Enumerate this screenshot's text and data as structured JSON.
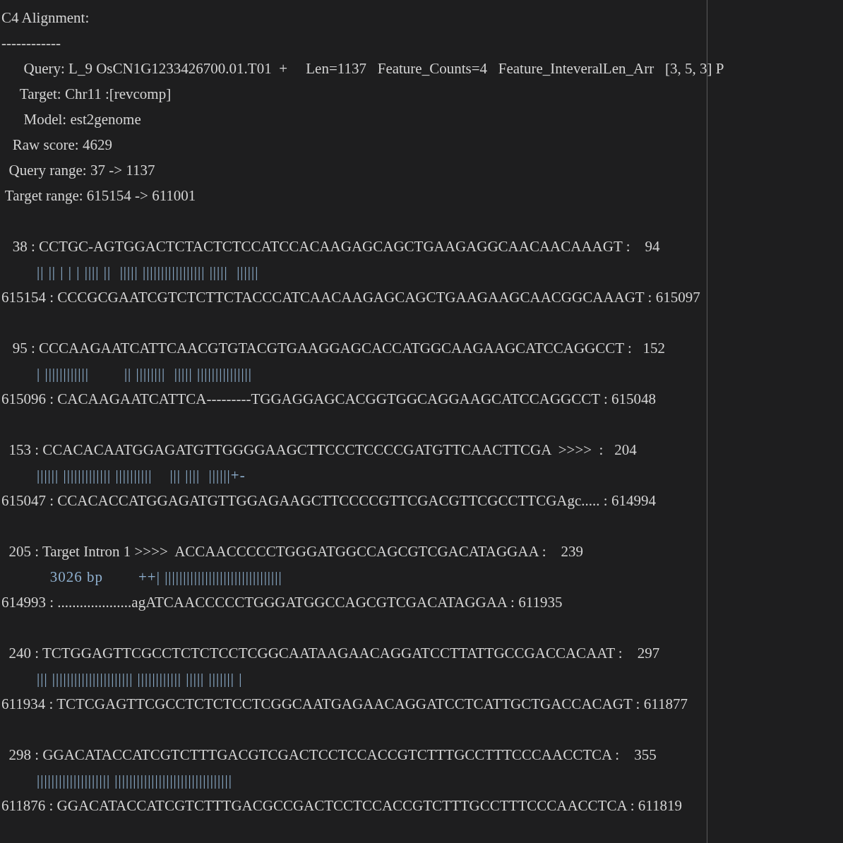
{
  "header_lines": [
    "C4 Alignment:",
    "------------",
    "      Query: L_9 OsCN1G1233426700.01.T01  +     Len=1137   Feature_Counts=4   Feature_InteveralLen_Arr   [3, 5, 3] P",
    "     Target: Chr11 :[revcomp]",
    "      Model: est2genome",
    "   Raw score: 4629",
    "  Query range: 37 -> 1137",
    " Target range: 615154 -> 611001"
  ],
  "blocks": [
    {
      "query": "   38 : CCTGC-AGTGGACTCTACTCTCCATCCACAAGAGCAGCTGAAGAGGCAACAACAAAGT :    94",
      "match": "        || || | | | |||| ||  ||||| ||||||||||||||||| |||||  ||||||",
      "target": "615154 : CCCGCGAATCGTCTCTTCTACCCATCAACAAGAGCAGCTGAAGAAGCAACGGCAAAGT : 615097"
    },
    {
      "query": "   95 : CCCAAGAATCATTCAACGTGTACGTGAAGGAGCACCATGGCAAGAAGCATCCAGGCCT :   152",
      "match": "        | ||||||||||||        || ||||||||  ||||| |||||||||||||||",
      "target": "615096 : CACAAGAATCATTCA---------TGGAGGAGCACGGTGGCAGGAAGCATCCAGGCCT : 615048"
    },
    {
      "query": "  153 : CCACACAATGGAGATGTTGGGGAAGCTTCCCTCCCCGATGTTCAACTTCGA  >>>>  :   204",
      "match": "        |||||| ||||||||||||| ||||||||||    ||| ||||  ||||||+-",
      "target": "615047 : CCACACCATGGAGATGTTGGAGAAGCTTCCCCGTTCGACGTTCGCCTTCGAgc..... : 614994"
    },
    {
      "query": "  205 : Target Intron 1 >>>>  ACCAACCCCCTGGGATGGCCAGCGTCGACATAGGAA :    239",
      "match": "           3026 bp        ++| ||||||||||||||||||||||||||||||||",
      "target": "614993 : ....................agATCAACCCCCTGGGATGGCCAGCGTCGACATAGGAA : 611935"
    },
    {
      "query": "  240 : TCTGGAGTTCGCCTCTCTCCTCGGCAATAAGAACAGGATCCTTATTGCCGACCACAAT :    297",
      "match": "        ||| |||||||||||||||||||||| |||||||||||| ||||| ||||||| |",
      "target": "611934 : TCTCGAGTTCGCCTCTCTCCTCGGCAATGAGAACAGGATCCTCATTGCTGACCACAGT : 611877"
    },
    {
      "query": "  298 : GGACATACCATCGTCTTTGACGTCGACTCCTCCACCGTCTTTGCCTTTCCCAACCTCA :    355",
      "match": "        |||||||||||||||||||| ||||||||||||||||||||||||||||||||",
      "target": "611876 : GGACATACCATCGTCTTTGACGCCGACTCCTCCACCGTCTTTGCCTTTCCCAACCTCA : 611819"
    }
  ]
}
